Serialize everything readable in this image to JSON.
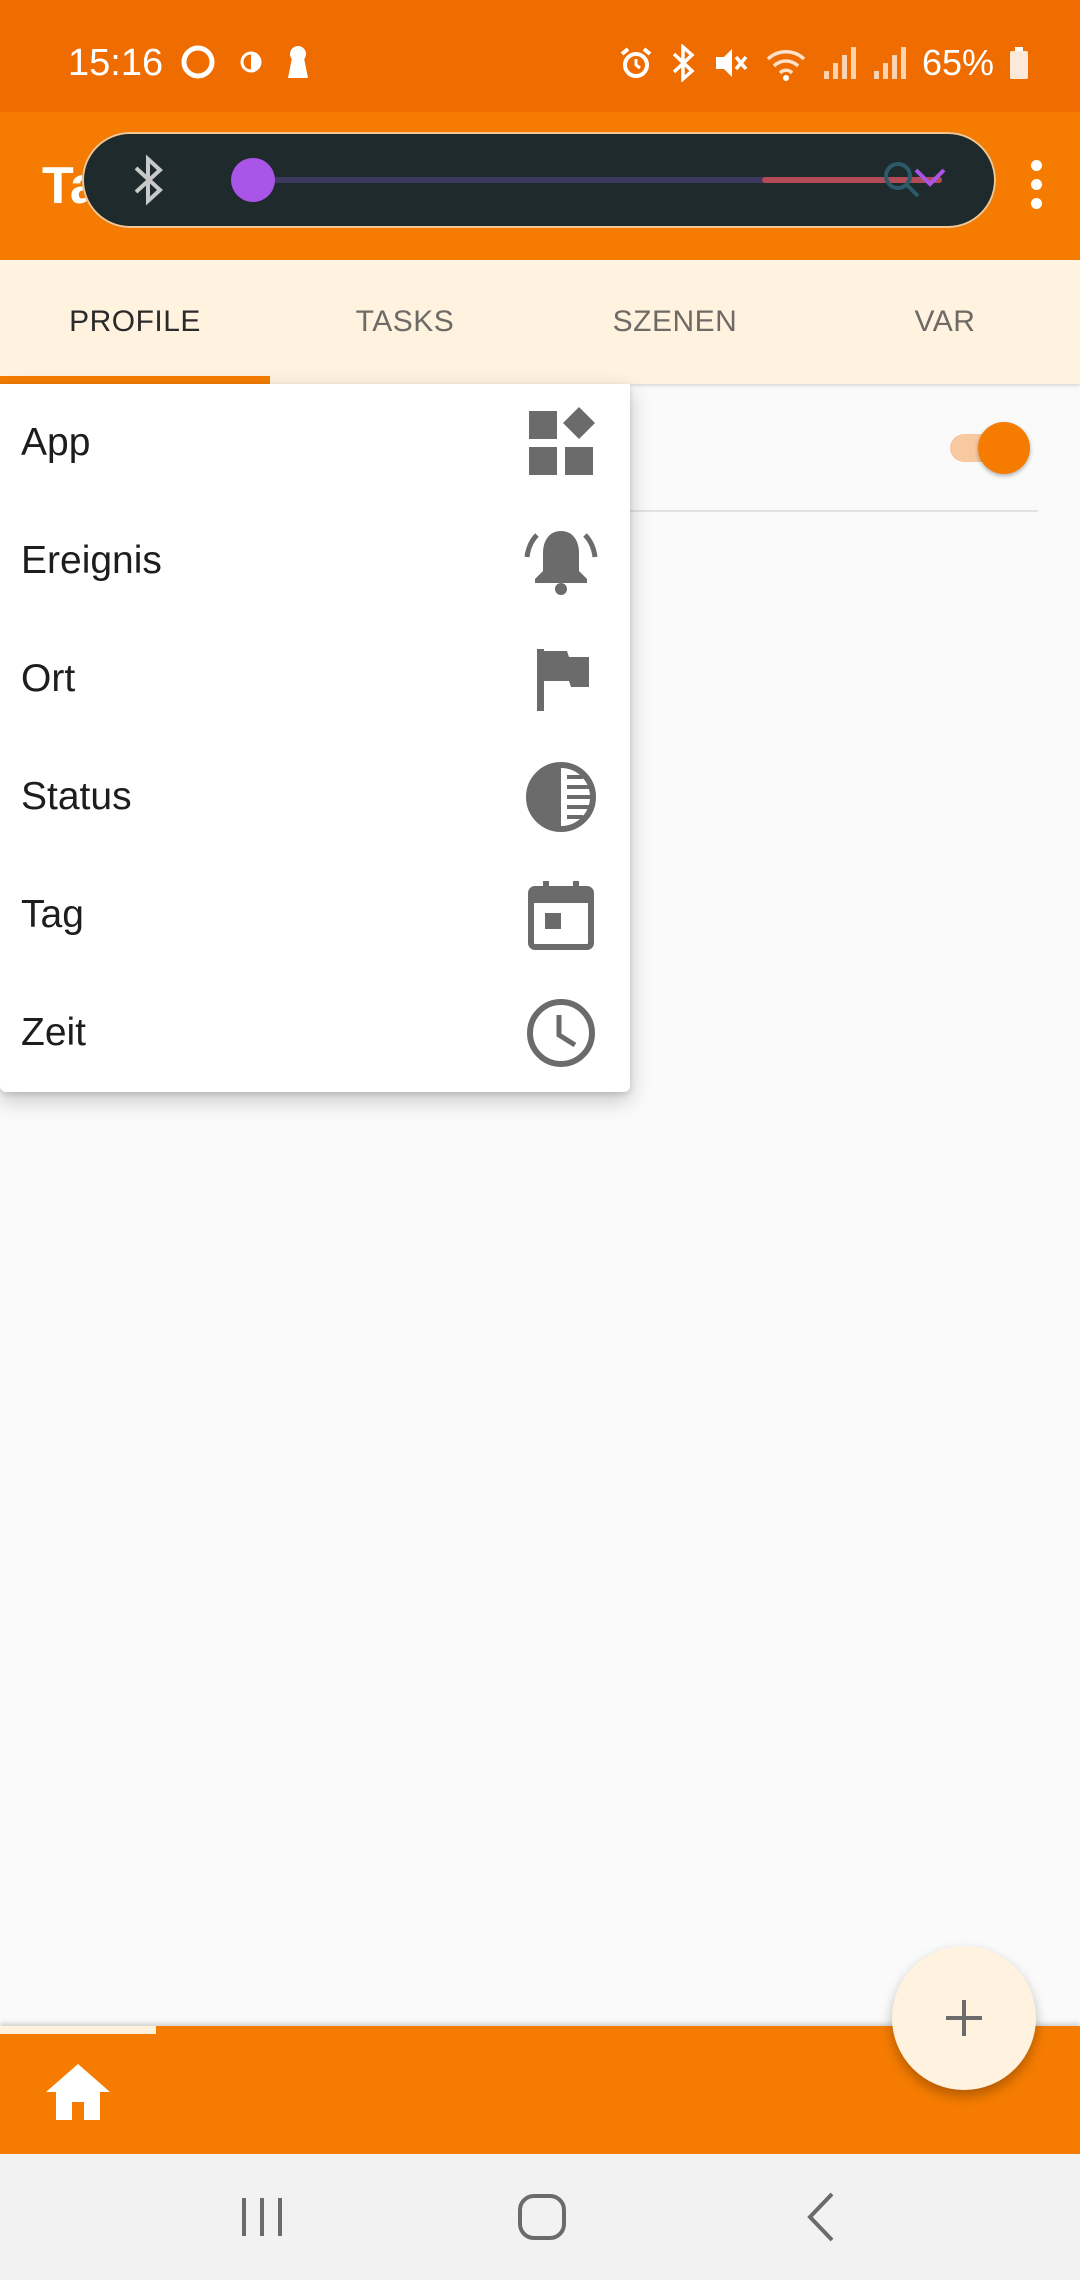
{
  "status_bar": {
    "time": "15:16",
    "battery_percent": "65%"
  },
  "app_bar": {
    "title": "Tasker"
  },
  "volume_overlay": {
    "level_fraction": 0.03
  },
  "tabs": [
    {
      "label": "PROFILE",
      "active": true
    },
    {
      "label": "TASKS",
      "active": false
    },
    {
      "label": "SZENEN",
      "active": false
    },
    {
      "label": "VAR",
      "active": false
    }
  ],
  "popup_menu": {
    "items": [
      {
        "label": "App",
        "icon": "widgets-icon"
      },
      {
        "label": "Ereignis",
        "icon": "bell-ringing-icon"
      },
      {
        "label": "Ort",
        "icon": "flag-icon"
      },
      {
        "label": "Status",
        "icon": "contrast-icon"
      },
      {
        "label": "Tag",
        "icon": "calendar-icon"
      },
      {
        "label": "Zeit",
        "icon": "clock-icon"
      }
    ]
  },
  "colors": {
    "primary": "#f57c00",
    "status_bar": "#ef6c00",
    "tab_background": "#fff3e0"
  }
}
